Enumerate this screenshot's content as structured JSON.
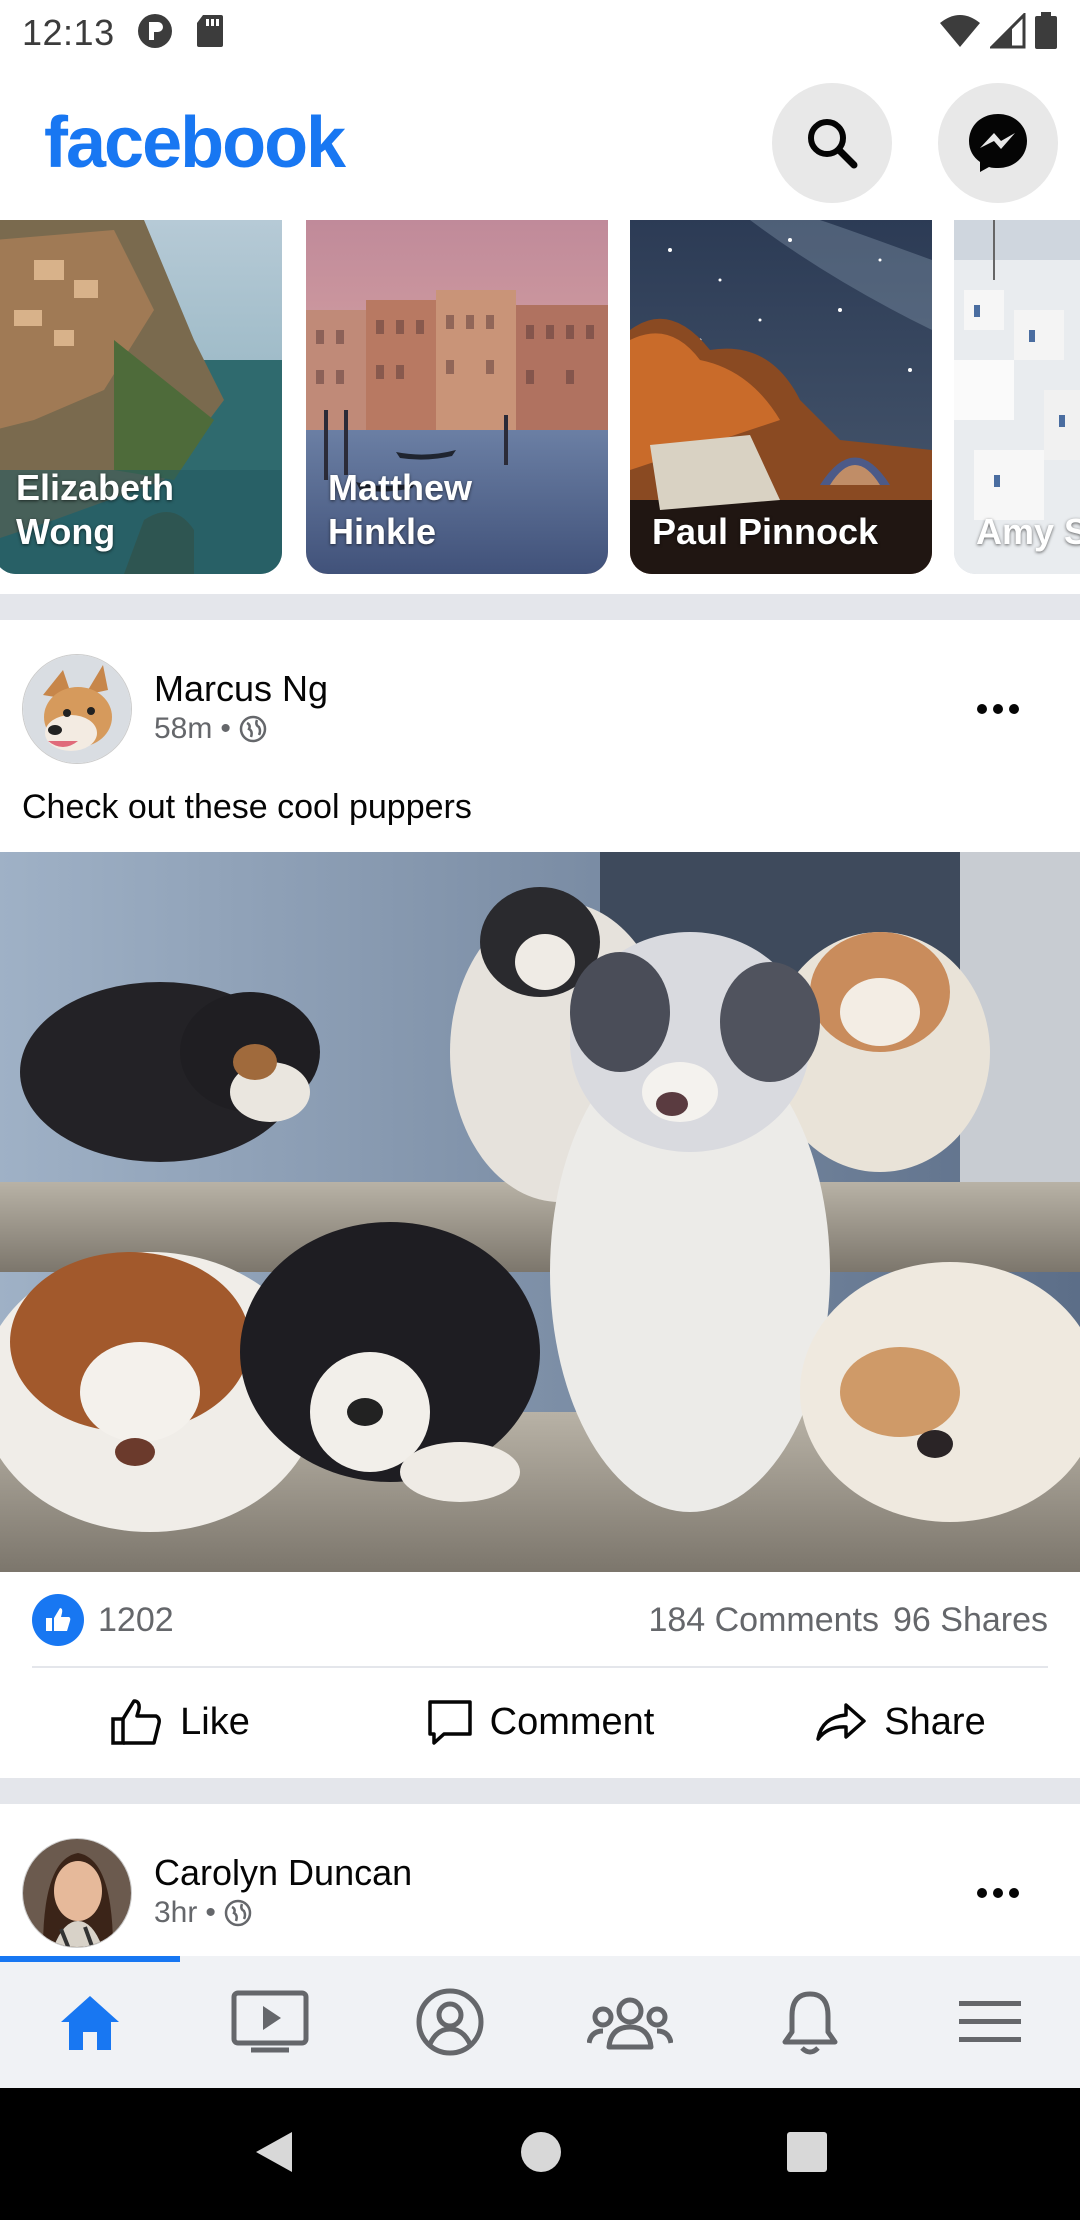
{
  "status_bar": {
    "time": "12:13",
    "icons": [
      "p-badge-icon",
      "sd-card-icon",
      "wifi-icon",
      "signal-icon",
      "battery-icon"
    ]
  },
  "header": {
    "logo": "facebook",
    "buttons": [
      "search-icon",
      "messenger-icon"
    ]
  },
  "stories": [
    {
      "name": "Elizabeth Wong",
      "line1": "Elizabeth",
      "line2": "Wong"
    },
    {
      "name": "Matthew Hinkle",
      "line1": "Matthew",
      "line2": "Hinkle"
    },
    {
      "name": "Paul Pinnock",
      "line1": "",
      "line2": "Paul Pinnock"
    },
    {
      "name": "Amy S",
      "line1": "",
      "line2": "Amy S"
    }
  ],
  "posts": [
    {
      "author": "Marcus Ng",
      "time": "58m",
      "privacy": "globe-icon",
      "text": "Check out these cool puppers",
      "likes": "1202",
      "comments": "184 Comments",
      "shares": "96 Shares",
      "actions": {
        "like": "Like",
        "comment": "Comment",
        "share": "Share"
      }
    },
    {
      "author": "Carolyn Duncan",
      "time": "3hr",
      "privacy": "globe-icon"
    }
  ],
  "bottom_nav": {
    "items": [
      "home-icon",
      "watch-icon",
      "profile-icon",
      "groups-icon",
      "notifications-icon",
      "menu-icon"
    ],
    "active_index": 0
  },
  "system_nav": [
    "back-icon",
    "home-circle-icon",
    "recents-icon"
  ],
  "colors": {
    "brand": "#1877f2",
    "secondary_text": "#65676b",
    "separator": "#e4e6eb",
    "nav_bg": "#f0f2f5"
  }
}
